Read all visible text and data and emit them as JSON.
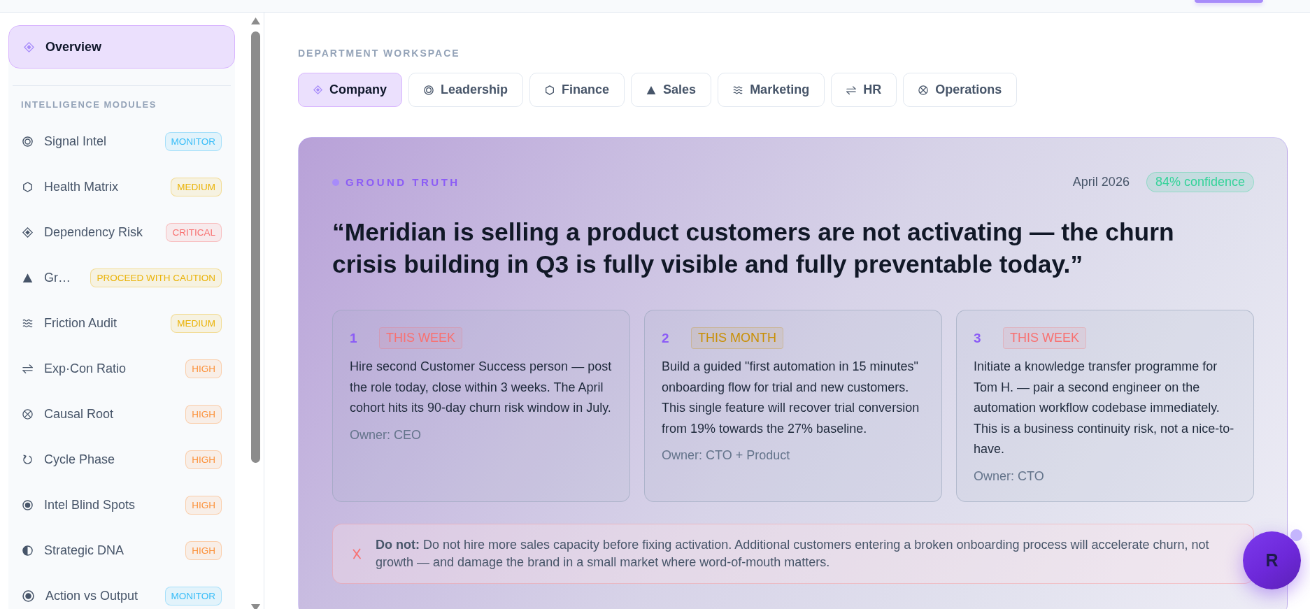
{
  "sidebar": {
    "overview": {
      "label": "Overview",
      "selected": true
    },
    "section_title": "INTELLIGENCE MODULES",
    "modules": [
      {
        "label": "Signal Intel",
        "selected": false,
        "badge": {
          "text": "MONITOR",
          "color": "#38bdf8"
        }
      },
      {
        "label": "Health Matrix",
        "selected": false,
        "badge": {
          "text": "MEDIUM",
          "color": "#eab308"
        }
      },
      {
        "label": "Dependency Risk",
        "selected": false,
        "badge": {
          "text": "CRITICAL",
          "color": "#f87171"
        }
      },
      {
        "label": "Gr…",
        "selected": false,
        "badge": {
          "text": "PROCEED WITH CAUTION",
          "color": "#eab308"
        }
      },
      {
        "label": "Friction Audit",
        "selected": false,
        "badge": {
          "text": "MEDIUM",
          "color": "#eab308"
        }
      },
      {
        "label": "Exp·Con Ratio",
        "selected": false,
        "badge": {
          "text": "HIGH",
          "color": "#fb923c"
        }
      },
      {
        "label": "Causal Root",
        "selected": false,
        "badge": {
          "text": "HIGH",
          "color": "#fb923c"
        }
      },
      {
        "label": "Cycle Phase",
        "selected": false,
        "badge": {
          "text": "HIGH",
          "color": "#fb923c"
        }
      },
      {
        "label": "Intel Blind Spots",
        "selected": false,
        "badge": {
          "text": "HIGH",
          "color": "#fb923c"
        }
      },
      {
        "label": "Strategic DNA",
        "selected": false,
        "badge": {
          "text": "HIGH",
          "color": "#fb923c"
        }
      },
      {
        "label": "Action vs Output",
        "selected": false,
        "badge": {
          "text": "MONITOR",
          "color": "#38bdf8"
        }
      }
    ]
  },
  "workspace": {
    "label": "DEPARTMENT WORKSPACE",
    "tabs": [
      {
        "label": "Company",
        "selected": true
      },
      {
        "label": "Leadership",
        "selected": false
      },
      {
        "label": "Finance",
        "selected": false
      },
      {
        "label": "Sales",
        "selected": false
      },
      {
        "label": "Marketing",
        "selected": false
      },
      {
        "label": "HR",
        "selected": false
      },
      {
        "label": "Operations",
        "selected": false
      }
    ]
  },
  "ground_truth": {
    "label": "GROUND TRUTH",
    "date": "April 2026",
    "confidence": "84% confidence",
    "quote": "“Meridian is selling a product customers are not activating — the churn crisis building in Q3 is fully visible and fully preventable today.”",
    "actions": [
      {
        "number": "1",
        "tag": {
          "text": "THIS WEEK",
          "color": "#f87171"
        },
        "text": "Hire second Customer Success person — post the role today, close within 3 weeks. The April cohort hits its 90-day churn risk window in July.",
        "owner": "Owner: CEO"
      },
      {
        "number": "2",
        "tag": {
          "text": "THIS MONTH",
          "color": "#c98f03"
        },
        "text": "Build a guided \"first automation in 15 minutes\" onboarding flow for trial and new customers. This single feature will recover trial conversion from 19% towards the 27% baseline.",
        "owner": "Owner: CTO + Product"
      },
      {
        "number": "3",
        "tag": {
          "text": "THIS WEEK",
          "color": "#f87171"
        },
        "text": "Initiate a knowledge transfer programme for Tom H. — pair a second engineer on the automation workflow codebase immediately. This is a business continuity risk, not a nice-to-have.",
        "owner": "Owner: CTO"
      }
    ],
    "warning": {
      "text": "**Do not:** Do not hire more sales capacity before fixing activation. Additional customers entering a broken onboarding process will accelerate churn, not growth — and damage the brand in a small market where word-of-mouth matters."
    }
  },
  "avatar": {
    "initial": "R",
    "notification": true
  }
}
